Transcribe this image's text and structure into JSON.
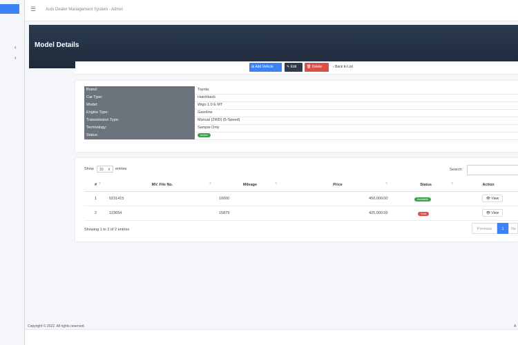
{
  "app": {
    "title": "Auto Dealer Management System - Admin"
  },
  "page": {
    "title": "Model Details"
  },
  "toolbar": {
    "add_vehicle": "Add Vehicle",
    "edit": "Edit",
    "delete": "Delete",
    "back": "Back to List"
  },
  "details": [
    {
      "label": "Brand:",
      "value": "Toyota"
    },
    {
      "label": "Car Type:",
      "value": "Hatchback"
    },
    {
      "label": "Model:",
      "value": "Wigo 1.0 E MT"
    },
    {
      "label": "Engine Type:",
      "value": "Gasoline"
    },
    {
      "label": "Transmission Type:",
      "value": "Manual (2WD) (5-Speed)"
    },
    {
      "label": "Technology:",
      "value": "Sample Only"
    },
    {
      "label": "Status:",
      "value": "Active"
    }
  ],
  "table_controls": {
    "show": "Show",
    "length": "10",
    "entries": "entries",
    "search_label": "Search:"
  },
  "table": {
    "headers": [
      "#",
      "MV. File No.",
      "Mileage",
      "Price",
      "Status",
      "Action"
    ],
    "rows": [
      {
        "num": "1",
        "file_no": "0231415",
        "mileage": "10000",
        "price": "450,000.00",
        "status": "Available",
        "action": "View"
      },
      {
        "num": "2",
        "file_no": "123654",
        "mileage": "15879",
        "price": "425,000.00",
        "status": "Sold",
        "action": "View"
      }
    ],
    "info": "Showing 1 to 2 of 2 entries"
  },
  "pagination": {
    "previous": "Previous",
    "current": "1",
    "next": "Ne"
  },
  "footer": {
    "copyright": "Copyright © 2022. All rights reserved.",
    "right": "A"
  },
  "colors": {
    "header": "#1f2a3a",
    "primary": "#3b82f6",
    "danger": "#dc4f49",
    "success": "#3fa34d"
  }
}
